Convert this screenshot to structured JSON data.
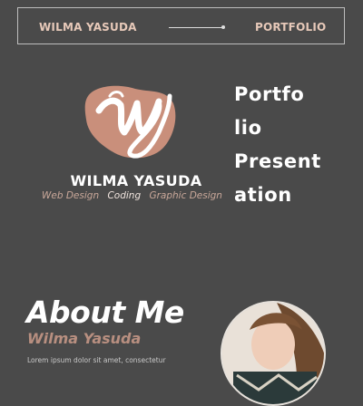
{
  "header": {
    "name": "WILMA YASUDA",
    "portfolio": "PORTFOLIO"
  },
  "brand": {
    "name": "WILMA YASUDA",
    "skills": [
      "Web Design",
      "Coding",
      "Graphic Design"
    ]
  },
  "title_lines": [
    "Portfo",
    "lio",
    "Present",
    "ation"
  ],
  "about": {
    "title": "About Me",
    "subtitle": "Wilma Yasuda",
    "text": "Lorem ipsum dolor sit amet, consectetur"
  },
  "colors": {
    "background": "#4a4a4a",
    "accent": "#c98f7b",
    "header_text": "#e7c9b9"
  }
}
